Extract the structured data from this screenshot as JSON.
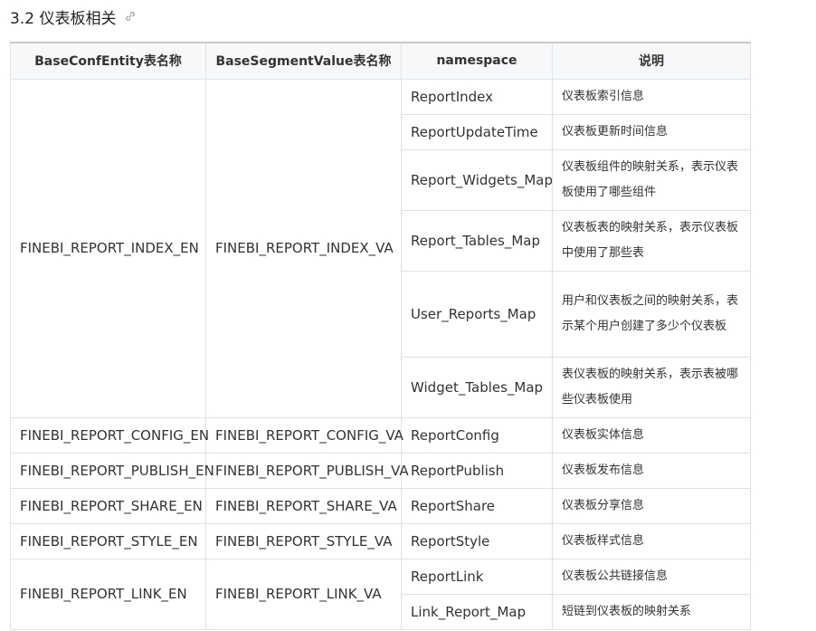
{
  "heading": {
    "title": "3.2 仪表板相关",
    "link_icon": "link-icon"
  },
  "table": {
    "headers": [
      "BaseConfEntity表名称",
      "BaseSegmentValue表名称",
      "namespace",
      "说明"
    ],
    "groups": [
      {
        "entity": "FINEBI_REPORT_INDEX_EN",
        "segment": "FINEBI_REPORT_INDEX_VA",
        "rows": [
          {
            "namespace": "ReportIndex",
            "desc": "仪表板索引信息"
          },
          {
            "namespace": "ReportUpdateTime",
            "desc": "仪表板更新时间信息"
          },
          {
            "namespace": "Report_Widgets_Map",
            "desc": "仪表板组件的映射关系，表示仪表板使用了哪些组件"
          },
          {
            "namespace": "Report_Tables_Map",
            "desc": "仪表板表的映射关系，表示仪表板中使用了那些表"
          },
          {
            "namespace": "User_Reports_Map",
            "desc": "用户和仪表板之间的映射关系，表示某个用户创建了多少个仪表板"
          },
          {
            "namespace": "Widget_Tables_Map",
            "desc": "表仪表板的映射关系，表示表被哪些仪表板使用"
          }
        ]
      },
      {
        "entity": "FINEBI_REPORT_CONFIG_EN",
        "segment": "FINEBI_REPORT_CONFIG_VA",
        "rows": [
          {
            "namespace": "ReportConfig",
            "desc": "仪表板实体信息"
          }
        ]
      },
      {
        "entity": "FINEBI_REPORT_PUBLISH_EN",
        "segment": "FINEBI_REPORT_PUBLISH_VA",
        "rows": [
          {
            "namespace": "ReportPublish",
            "desc": "仪表板发布信息"
          }
        ]
      },
      {
        "entity": "FINEBI_REPORT_SHARE_EN",
        "segment": "FINEBI_REPORT_SHARE_VA",
        "rows": [
          {
            "namespace": "ReportShare",
            "desc": "仪表板分享信息"
          }
        ]
      },
      {
        "entity": "FINEBI_REPORT_STYLE_EN",
        "segment": "FINEBI_REPORT_STYLE_VA",
        "rows": [
          {
            "namespace": "ReportStyle",
            "desc": "仪表板样式信息"
          }
        ]
      },
      {
        "entity": "FINEBI_REPORT_LINK_EN",
        "segment": "FINEBI_REPORT_LINK_VA",
        "rows": [
          {
            "namespace": "ReportLink",
            "desc": "仪表板公共链接信息"
          },
          {
            "namespace": "Link_Report_Map",
            "desc": "短链到仪表板的映射关系"
          }
        ]
      }
    ]
  }
}
